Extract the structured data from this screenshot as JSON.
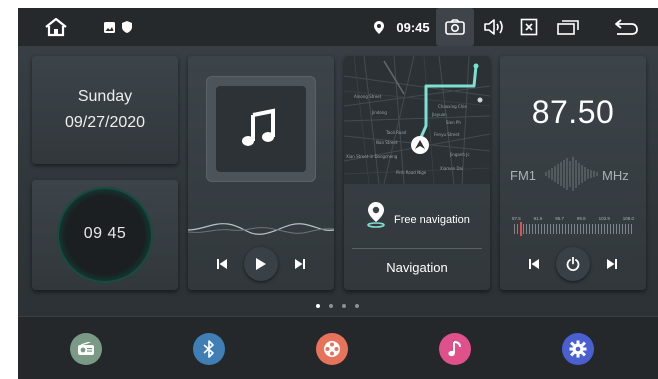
{
  "status_bar": {
    "time": "09:45",
    "icons": [
      "home-icon",
      "image-icon",
      "shield-icon",
      "location-pin-icon",
      "camera-icon",
      "volume-icon",
      "close-window-icon",
      "recent-apps-icon",
      "back-icon"
    ]
  },
  "date_card": {
    "day": "Sunday",
    "date": "09/27/2020"
  },
  "clock_card": {
    "time": "09 45"
  },
  "music_card": {
    "controls": [
      "previous",
      "play",
      "next"
    ]
  },
  "navigation_card": {
    "free_label": "Free navigation",
    "title": "Navigation",
    "map_labels": [
      "Ainong Street",
      "Chaoxing Chie",
      "Jiayuan",
      "Jindong",
      "Sien Ph",
      "Taoli Road",
      "Nan Street",
      "Xian Street in Dongcheng",
      "Fenyu Street",
      "Pinh Road Nige",
      "Jinganh Jc",
      "Xiamen Dai"
    ]
  },
  "radio_card": {
    "frequency": "87.50",
    "band": "FM1",
    "unit": "MHz",
    "scale": [
      "87.5",
      "91.6",
      "95.7",
      "99.8",
      "103.9",
      "108.0"
    ]
  },
  "page_indicator": {
    "pages": 4,
    "active": 1
  },
  "dock": {
    "apps": [
      {
        "name": "radio",
        "color": "#7a9a86"
      },
      {
        "name": "bluetooth",
        "color": "#3f7fb6"
      },
      {
        "name": "media",
        "color": "#e6735a"
      },
      {
        "name": "music",
        "color": "#e0508a"
      },
      {
        "name": "settings",
        "color": "#4a5fd0"
      }
    ]
  }
}
